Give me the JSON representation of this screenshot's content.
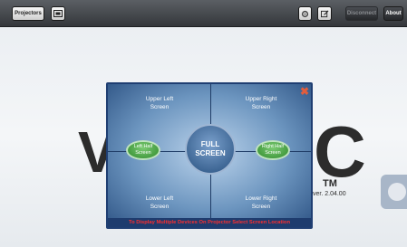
{
  "toolbar": {
    "projectors_label": "Projectors",
    "disconnect_label": "Disconnect",
    "about_label": "About"
  },
  "background": {
    "logo_left": "V",
    "logo_right": "C",
    "trademark": "TM",
    "version": "ver. 2.04.00"
  },
  "dialog": {
    "upper_left": "Upper Left\nScreen",
    "upper_right": "Upper Right\nScreen",
    "left_half": "Left Half\nScreen",
    "full_screen": "FULL\nSCREEN",
    "right_half": "Right Half\nScreen",
    "lower_left": "Lower Left\nScreen",
    "lower_right": "Lower Right\nScreen",
    "footer": "To Display Multiple Devices On Projector Select Screen Location"
  },
  "colors": {
    "footer_text": "#ff2e2e",
    "pill_green": "#2f8a2c",
    "dialog_border": "#1f3e72"
  }
}
